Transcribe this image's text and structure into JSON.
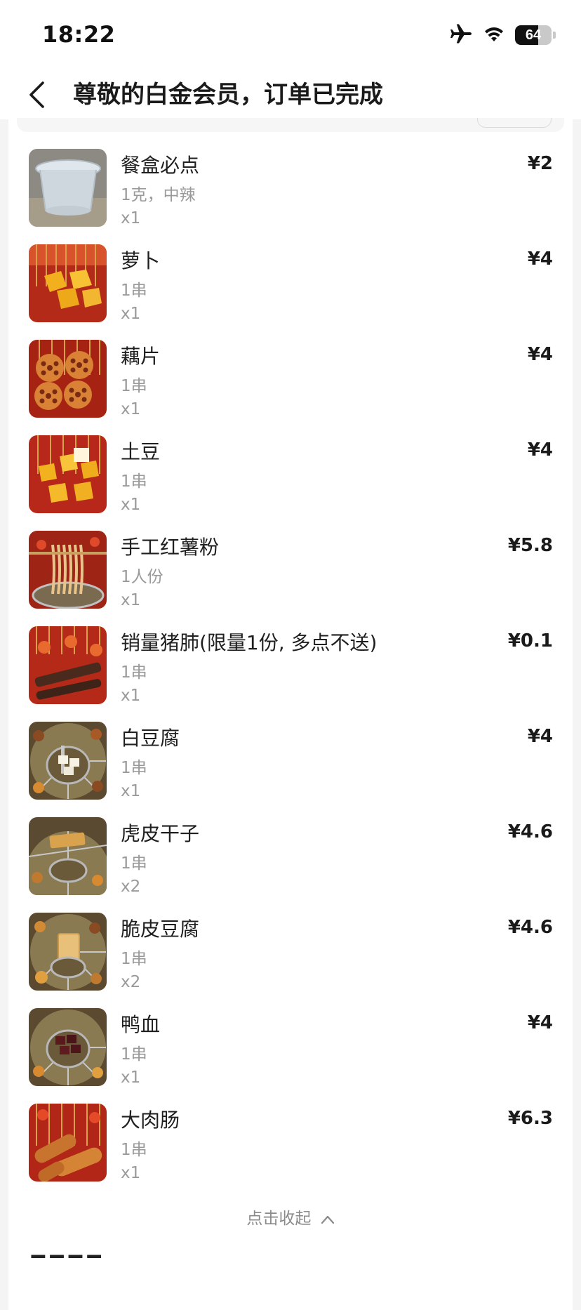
{
  "status": {
    "time": "18:22",
    "battery_percent": 64,
    "icons": [
      "airplane-icon",
      "wifi-icon",
      "battery-icon"
    ]
  },
  "header": {
    "title": "尊敬的白金会员，订单已完成",
    "back_icon": "chevron-left-icon"
  },
  "items": [
    {
      "name": "餐盒必点",
      "spec": "1克，中辣",
      "qty": "x1",
      "price": "¥2",
      "thumb": "container"
    },
    {
      "name": "萝卜",
      "spec": "1串",
      "qty": "x1",
      "price": "¥4",
      "thumb": "radish"
    },
    {
      "name": "藕片",
      "spec": "1串",
      "qty": "x1",
      "price": "¥4",
      "thumb": "lotus"
    },
    {
      "name": "土豆",
      "spec": "1串",
      "qty": "x1",
      "price": "¥4",
      "thumb": "potato"
    },
    {
      "name": "手工红薯粉",
      "spec": "1人份",
      "qty": "x1",
      "price": "¥5.8",
      "thumb": "noodles"
    },
    {
      "name": "销量猪肺(限量1份, 多点不送)",
      "spec": "1串",
      "qty": "x1",
      "price": "¥0.1",
      "thumb": "lung"
    },
    {
      "name": "白豆腐",
      "spec": "1串",
      "qty": "x1",
      "price": "¥4",
      "thumb": "tofu"
    },
    {
      "name": "虎皮干子",
      "spec": "1串",
      "qty": "x2",
      "price": "¥4.6",
      "thumb": "driedtofu"
    },
    {
      "name": "脆皮豆腐",
      "spec": "1串",
      "qty": "x2",
      "price": "¥4.6",
      "thumb": "crispytofu"
    },
    {
      "name": "鸭血",
      "spec": "1串",
      "qty": "x1",
      "price": "¥4",
      "thumb": "duckblood"
    },
    {
      "name": "大肉肠",
      "spec": "1串",
      "qty": "x1",
      "price": "¥6.3",
      "thumb": "sausage"
    }
  ],
  "collapse_label": "点击收起",
  "colors": {
    "accent_text": "#1a1a1a",
    "muted_text": "#9a9a9a",
    "hotpot_red": "#c8281e",
    "broth": "#8a7a52"
  }
}
